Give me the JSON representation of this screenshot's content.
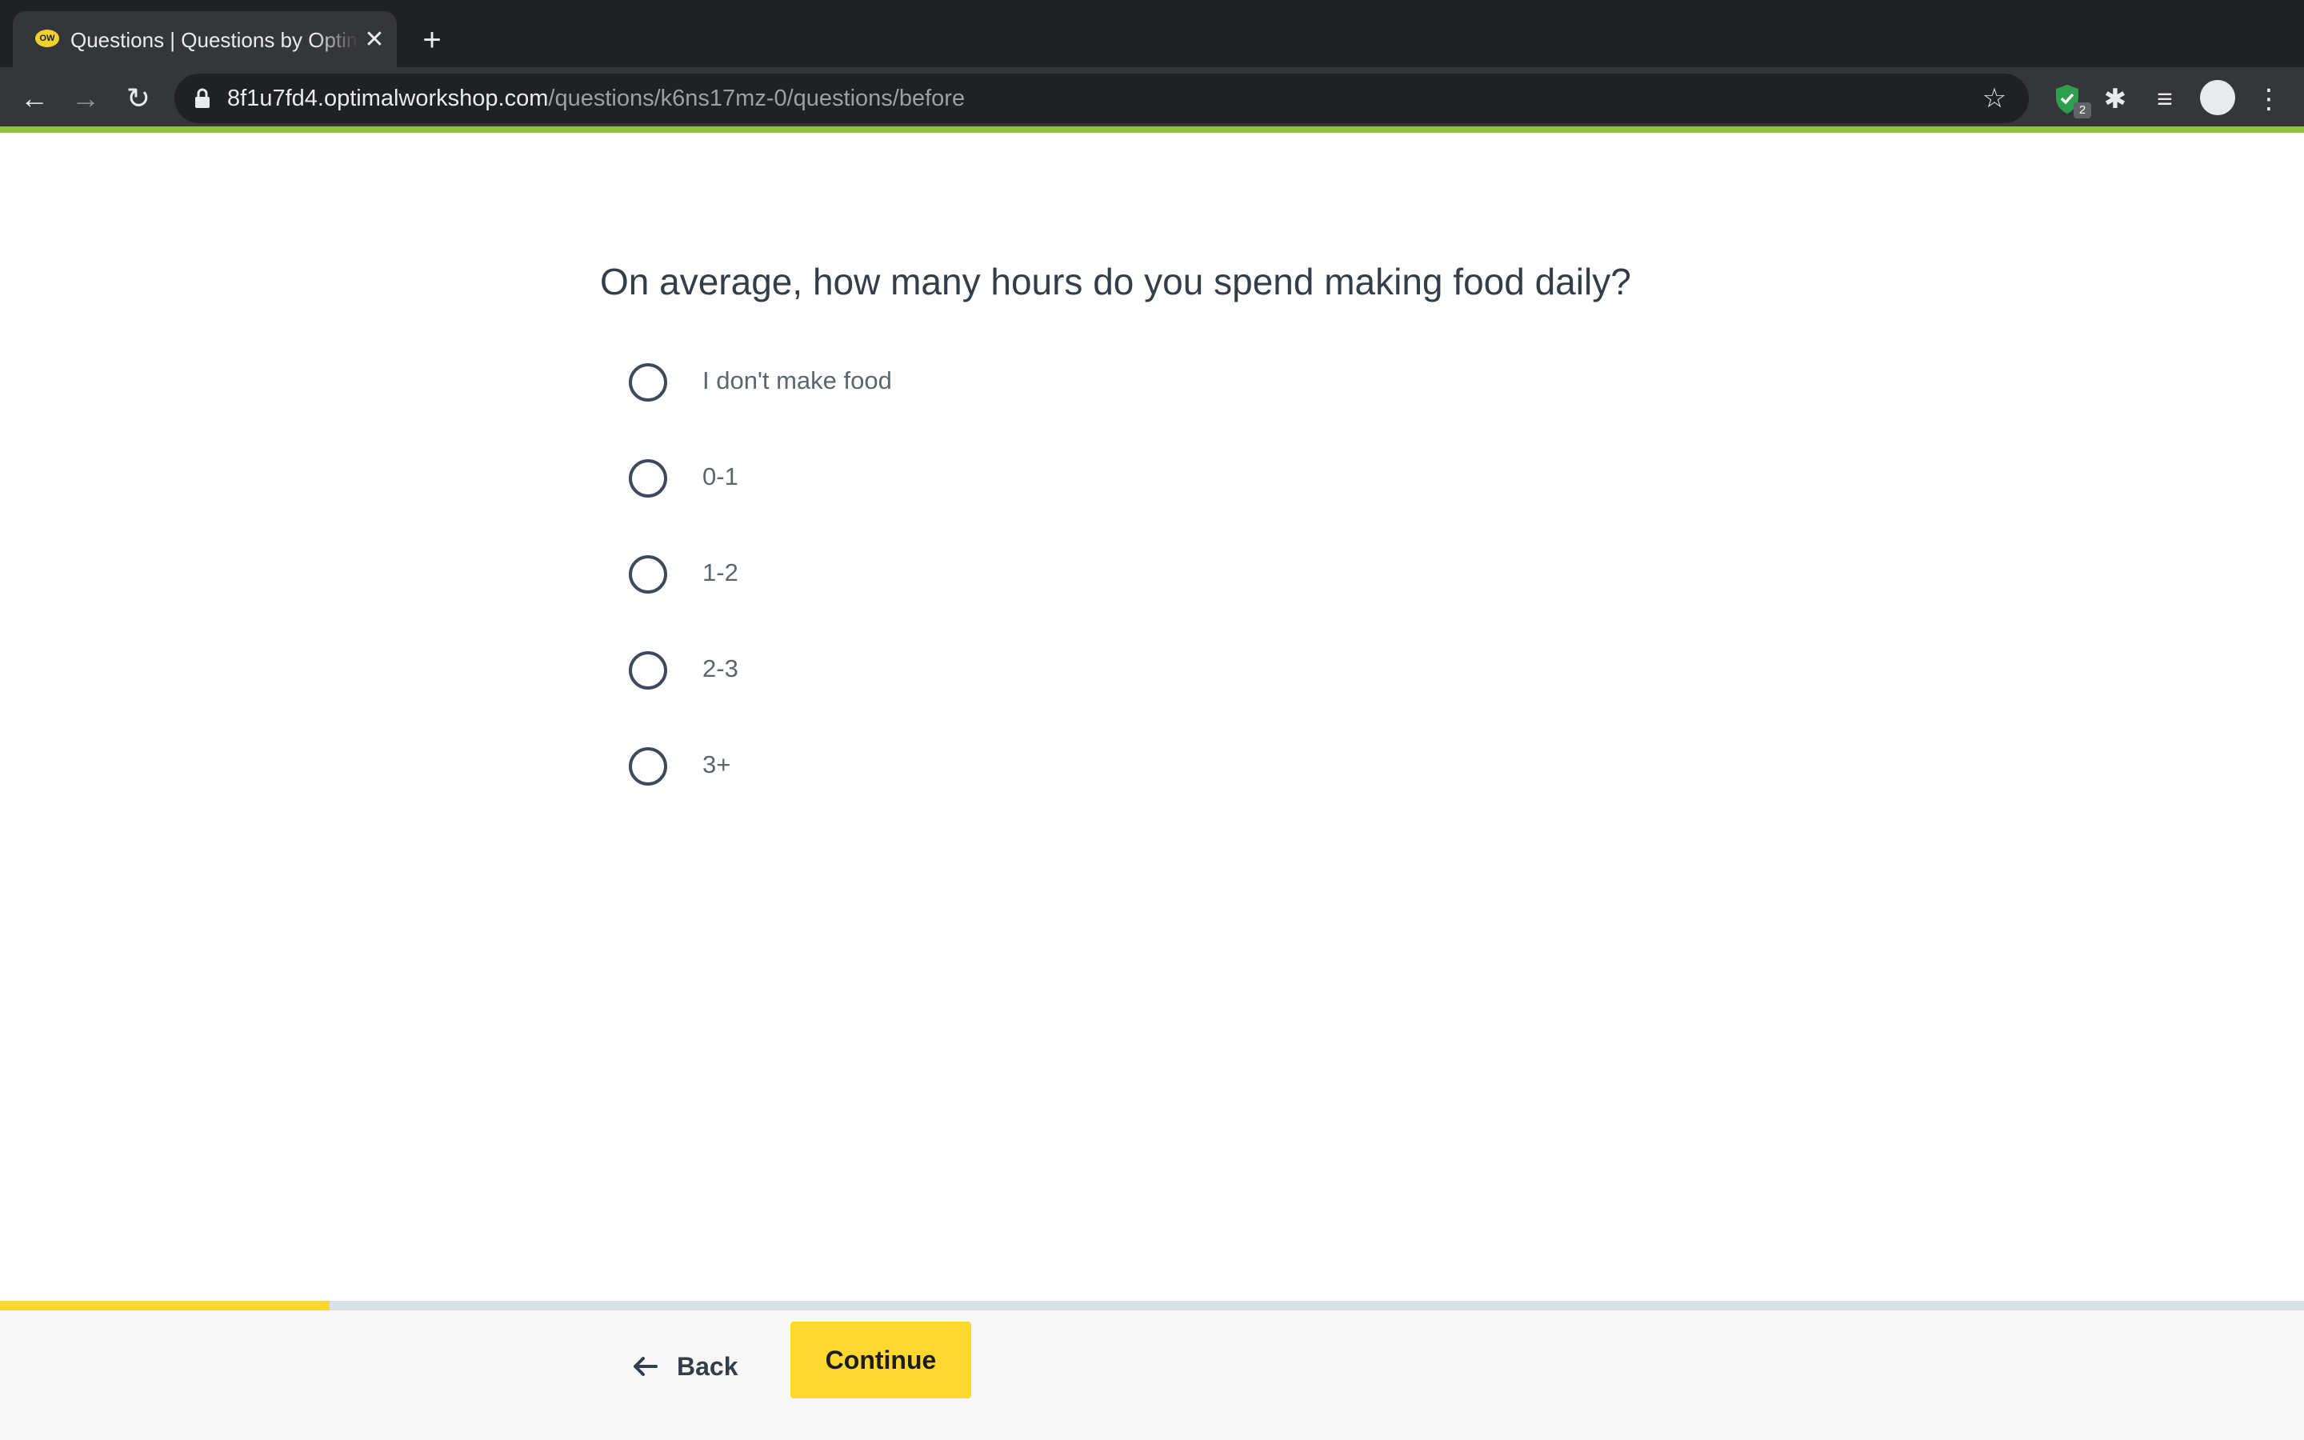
{
  "browser": {
    "tab": {
      "favicon_text": "OW",
      "title": "Questions | Questions by Optimal Workshop",
      "close_glyph": "✕"
    },
    "new_tab_glyph": "+",
    "nav": {
      "back_glyph": "←",
      "forward_glyph": "→",
      "reload_glyph": "↻"
    },
    "address": {
      "host": "8f1u7fd4.optimalworkshop.com",
      "path": "/questions/k6ns17mz-0/questions/before"
    },
    "extensions": {
      "shield_badge": "2",
      "puzzle_glyph": "✱",
      "media_glyph": "≡",
      "menu_glyph": "⋮",
      "star_glyph": "☆"
    },
    "colors": {
      "chrome_dark": "#202124",
      "chrome_toolbar": "#35363a",
      "accent_green": "#8fc33e"
    }
  },
  "survey": {
    "question": "On average, how many hours do you spend making food daily?",
    "options": [
      {
        "label": "I don't make food",
        "selected": false
      },
      {
        "label": "0-1",
        "selected": false
      },
      {
        "label": "1-2",
        "selected": false
      },
      {
        "label": "2-3",
        "selected": false
      },
      {
        "label": "3+",
        "selected": false
      }
    ],
    "progress_fraction": 0.143,
    "footer": {
      "back_label": "Back",
      "continue_label": "Continue"
    },
    "colors": {
      "primary_yellow": "#fed831",
      "text_dark": "#333e48"
    }
  }
}
